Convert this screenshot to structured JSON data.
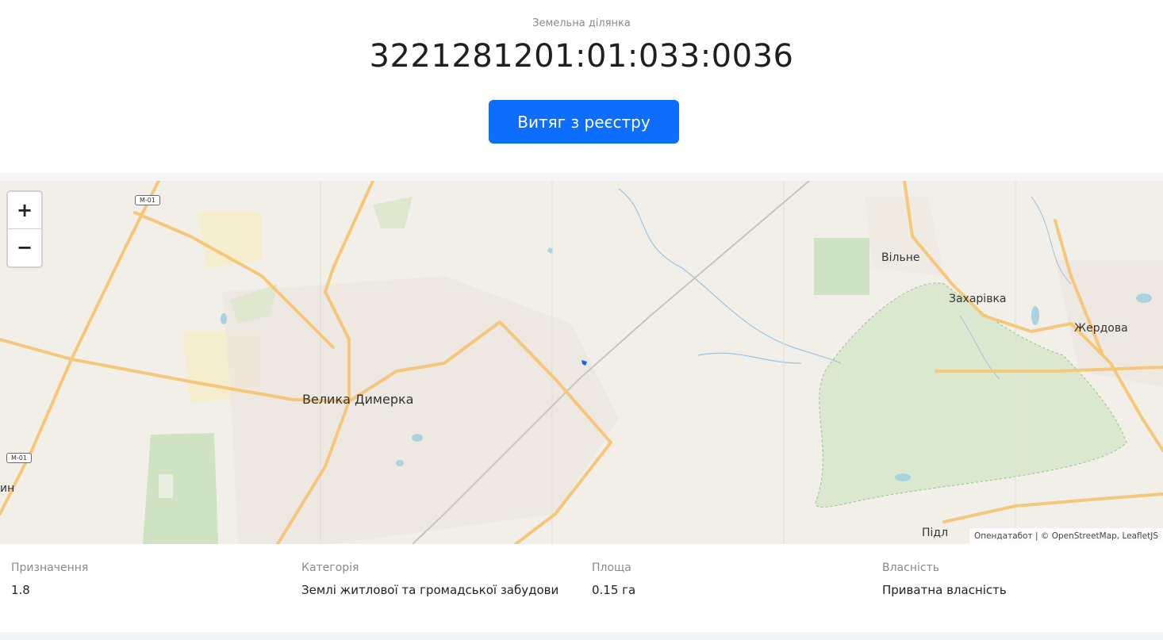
{
  "header": {
    "subtitle": "Земельна ділянка",
    "cadastral_number": "3221281201:01:033:0036",
    "extract_button": "Витяг з реєстру"
  },
  "map": {
    "zoom_in": "+",
    "zoom_out": "−",
    "places": {
      "velyka_dymerka": "Велика Димерка",
      "vilne": "Вільне",
      "zakharivka": "Захарівка",
      "zherdova": "Жердова",
      "pidl": "Підл",
      "left_edge": "ин"
    },
    "road_shields": {
      "top": "M-01",
      "left": "M-01"
    },
    "attribution": "Опендатабот | © OpenStreetMap, LeafletJS"
  },
  "details": {
    "purpose": {
      "label": "Призначення",
      "value": "1.8"
    },
    "category": {
      "label": "Категорія",
      "value": "Землі житлової та громадської забудови"
    },
    "area": {
      "label": "Площа",
      "value": "0.15 га"
    },
    "ownership": {
      "label": "Власність",
      "value": "Приватна власність"
    }
  },
  "colors": {
    "button": "#0d6efd",
    "parcel_marker": "#1565e0",
    "forest": "#d9e8cf",
    "road": "#f5c77a"
  }
}
